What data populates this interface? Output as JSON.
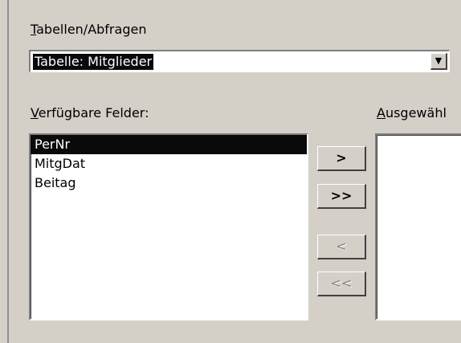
{
  "form": {
    "tables_label": "Tabellen/Abfragen",
    "table_select_value": "Tabelle: Mitglieder",
    "available_label": "Verfügbare Felder:",
    "selected_label": "Ausgewähl"
  },
  "available_fields": [
    "PerNr",
    "MitgDat",
    "Beitag"
  ],
  "selected_field_index": 0,
  "buttons": {
    "add_one": ">",
    "add_all": ">>",
    "remove_one": "<",
    "remove_all": "<<"
  },
  "icons": {
    "dropdown_arrow": "▼"
  }
}
